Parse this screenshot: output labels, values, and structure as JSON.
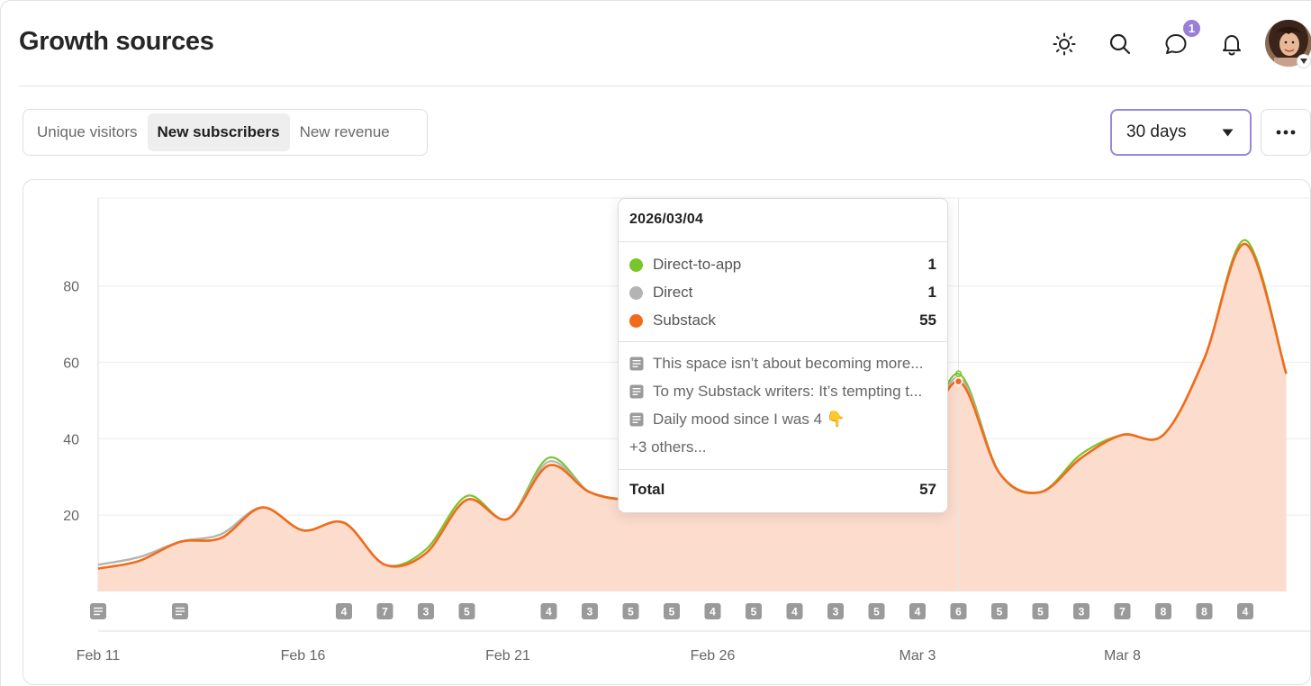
{
  "header": {
    "title": "Growth sources",
    "notification_badge": "1"
  },
  "icons": {
    "theme": "sun-icon",
    "search": "search-icon",
    "messages": "chat-bubble-icon",
    "notifications": "bell-icon",
    "avatar": "avatar"
  },
  "tabs": [
    {
      "label": "Unique visitors",
      "active": false
    },
    {
      "label": "New subscribers",
      "active": true
    },
    {
      "label": "New revenue",
      "active": false
    }
  ],
  "range_select": {
    "value": "30 days"
  },
  "colors": {
    "accent": "#9a86d8",
    "direct_to_app": "#7ac52a",
    "direct": "#b4b4b4",
    "substack": "#f26a1b",
    "area_fill": "#fcdccd"
  },
  "tooltip": {
    "date": "2026/03/04",
    "rows": [
      {
        "label": "Direct-to-app",
        "value": "1",
        "color": "#7ac52a"
      },
      {
        "label": "Direct",
        "value": "1",
        "color": "#b4b4b4"
      },
      {
        "label": "Substack",
        "value": "55",
        "color": "#f26a1b"
      }
    ],
    "posts": [
      "This space isn’t about becoming more...",
      "To my Substack writers: It’s tempting t...",
      "Daily mood since I was 4 👇"
    ],
    "others": "+3 others...",
    "total_label": "Total",
    "total_value": "57"
  },
  "chart_data": {
    "type": "area",
    "x": [
      "Feb 11",
      "Feb 12",
      "Feb 13",
      "Feb 14",
      "Feb 15",
      "Feb 16",
      "Feb 17",
      "Feb 18",
      "Feb 19",
      "Feb 20",
      "Feb 21",
      "Feb 22",
      "Feb 23",
      "Feb 24",
      "Feb 25",
      "Feb 26",
      "Feb 27",
      "Feb 28",
      "Mar 1",
      "Mar 2",
      "Mar 3",
      "Mar 4",
      "Mar 5",
      "Mar 6",
      "Mar 7",
      "Mar 8",
      "Mar 9",
      "Mar 10",
      "Mar 11",
      "Mar 12"
    ],
    "x_tick_labels": [
      "Feb 11",
      "Feb 16",
      "Feb 21",
      "Feb 26",
      "Mar 3",
      "Mar 8"
    ],
    "y_ticks": [
      20,
      40,
      60,
      80
    ],
    "ylim": [
      0,
      103
    ],
    "grid": true,
    "series": [
      {
        "name": "Direct-to-app",
        "values": [
          0,
          0,
          0,
          0,
          0,
          0,
          0,
          0,
          1,
          1,
          0,
          1,
          0,
          0,
          0,
          0,
          0,
          0,
          0,
          0,
          0,
          1,
          0,
          0,
          1,
          0,
          0,
          0,
          1,
          0
        ]
      },
      {
        "name": "Direct",
        "values": [
          1,
          1,
          0,
          1,
          0,
          0,
          0,
          0,
          0,
          0,
          0,
          1,
          0,
          0,
          0,
          0,
          0,
          0,
          0,
          0,
          0,
          1,
          0,
          0,
          0,
          0,
          0,
          0,
          0,
          0
        ]
      },
      {
        "name": "Substack",
        "values": [
          6,
          8,
          13,
          14,
          22,
          16,
          18,
          7,
          10,
          24,
          19,
          33,
          26,
          24,
          25,
          22,
          24,
          26,
          28,
          32,
          36,
          55,
          31,
          26,
          35,
          41,
          41,
          61,
          91,
          57
        ]
      }
    ],
    "post_markers": [
      "doc",
      "",
      "doc",
      "",
      "",
      "",
      "4",
      "7",
      "3",
      "5",
      "",
      "4",
      "3",
      "5",
      "5",
      "4",
      "5",
      "4",
      "3",
      "5",
      "4",
      "6",
      "5",
      "5",
      "3",
      "7",
      "8",
      "8",
      "4",
      ""
    ],
    "highlighted_index": 21
  }
}
